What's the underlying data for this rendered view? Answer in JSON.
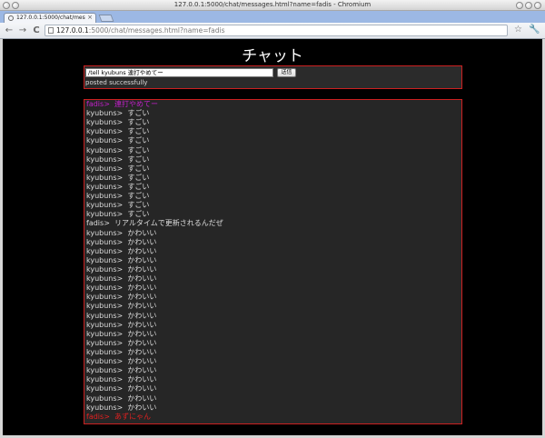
{
  "window": {
    "title": "127.0.0.1:5000/chat/messages.html?name=fadis - Chromium",
    "tab_label": "127.0.0.1:5000/chat/mes",
    "tab_close": "×"
  },
  "toolbar": {
    "back": "←",
    "forward": "→",
    "reload": "C",
    "url_host": "127.0.0.1",
    "url_path": ":5000/chat/messages.html?name=fadis",
    "star": "☆",
    "wrench": "🔧"
  },
  "page": {
    "heading": "チャット",
    "input_value": "/tell kyubuns 連打やめてー",
    "send_label": "送信",
    "status": "posted successfully"
  },
  "colors": {
    "whisper": "#c020c8",
    "self": "#e02020",
    "normal": "#dddddd"
  },
  "messages": [
    {
      "user": "fadis",
      "sep": "> ",
      "text": "連打やめてー",
      "kind": "whisper"
    },
    {
      "user": "kyubuns",
      "sep": "> ",
      "text": "すごい",
      "kind": "normal"
    },
    {
      "user": "kyubuns",
      "sep": "> ",
      "text": "すごい",
      "kind": "normal"
    },
    {
      "user": "kyubuns",
      "sep": "> ",
      "text": "すごい",
      "kind": "normal"
    },
    {
      "user": "kyubuns",
      "sep": "> ",
      "text": "すごい",
      "kind": "normal"
    },
    {
      "user": "kyubuns",
      "sep": "> ",
      "text": "すごい",
      "kind": "normal"
    },
    {
      "user": "kyubuns",
      "sep": "> ",
      "text": "すごい",
      "kind": "normal"
    },
    {
      "user": "kyubuns",
      "sep": "> ",
      "text": "すごい",
      "kind": "normal"
    },
    {
      "user": "kyubuns",
      "sep": "> ",
      "text": "すごい",
      "kind": "normal"
    },
    {
      "user": "kyubuns",
      "sep": "> ",
      "text": "すごい",
      "kind": "normal"
    },
    {
      "user": "kyubuns",
      "sep": "> ",
      "text": "すごい",
      "kind": "normal"
    },
    {
      "user": "kyubuns",
      "sep": "> ",
      "text": "すごい",
      "kind": "normal"
    },
    {
      "user": "kyubuns",
      "sep": "> ",
      "text": "すごい",
      "kind": "normal"
    },
    {
      "user": "fadis",
      "sep": "> ",
      "text": "リアルタイムで更新されるんだぜ",
      "kind": "normal"
    },
    {
      "user": "kyubuns",
      "sep": "> ",
      "text": "かわいい",
      "kind": "normal"
    },
    {
      "user": "kyubuns",
      "sep": "> ",
      "text": "かわいい",
      "kind": "normal"
    },
    {
      "user": "kyubuns",
      "sep": "> ",
      "text": "かわいい",
      "kind": "normal"
    },
    {
      "user": "kyubuns",
      "sep": "> ",
      "text": "かわいい",
      "kind": "normal"
    },
    {
      "user": "kyubuns",
      "sep": "> ",
      "text": "かわいい",
      "kind": "normal"
    },
    {
      "user": "kyubuns",
      "sep": "> ",
      "text": "かわいい",
      "kind": "normal"
    },
    {
      "user": "kyubuns",
      "sep": "> ",
      "text": "かわいい",
      "kind": "normal"
    },
    {
      "user": "kyubuns",
      "sep": "> ",
      "text": "かわいい",
      "kind": "normal"
    },
    {
      "user": "kyubuns",
      "sep": "> ",
      "text": "かわいい",
      "kind": "normal"
    },
    {
      "user": "kyubuns",
      "sep": "> ",
      "text": "かわいい",
      "kind": "normal"
    },
    {
      "user": "kyubuns",
      "sep": "> ",
      "text": "かわいい",
      "kind": "normal"
    },
    {
      "user": "kyubuns",
      "sep": "> ",
      "text": "かわいい",
      "kind": "normal"
    },
    {
      "user": "kyubuns",
      "sep": "> ",
      "text": "かわいい",
      "kind": "normal"
    },
    {
      "user": "kyubuns",
      "sep": "> ",
      "text": "かわいい",
      "kind": "normal"
    },
    {
      "user": "kyubuns",
      "sep": "> ",
      "text": "かわいい",
      "kind": "normal"
    },
    {
      "user": "kyubuns",
      "sep": "> ",
      "text": "かわいい",
      "kind": "normal"
    },
    {
      "user": "kyubuns",
      "sep": "> ",
      "text": "かわいい",
      "kind": "normal"
    },
    {
      "user": "kyubuns",
      "sep": "> ",
      "text": "かわいい",
      "kind": "normal"
    },
    {
      "user": "kyubuns",
      "sep": "> ",
      "text": "かわいい",
      "kind": "normal"
    },
    {
      "user": "kyubuns",
      "sep": "> ",
      "text": "かわいい",
      "kind": "normal"
    },
    {
      "user": "fadis",
      "sep": "> ",
      "text": "あずにゃん",
      "kind": "self"
    }
  ]
}
